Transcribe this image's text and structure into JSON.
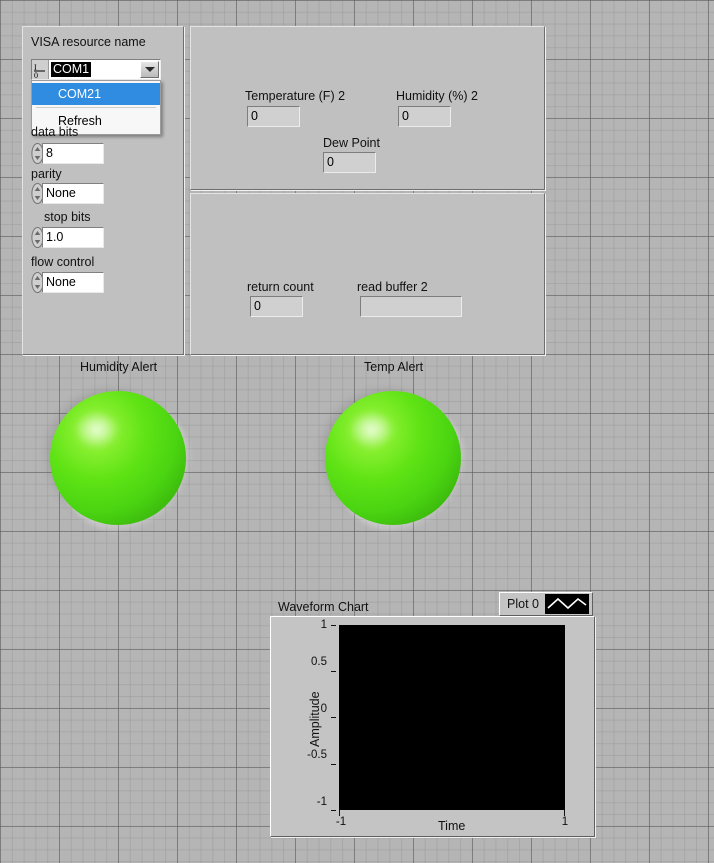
{
  "window": {
    "title": "LabVIEW Front Panel",
    "background_color": "#b5b5b5",
    "panel_color": "#c0c0c0"
  },
  "serial_config_panel": {
    "name": "serial-configuration-panel",
    "visa": {
      "label": "VISA resource name",
      "value": "COM1",
      "io_glyph": "I/O",
      "dropdown_open": true,
      "options": [
        {
          "label": "COM21",
          "selected": true
        },
        {
          "label": "Refresh",
          "selected": false
        }
      ]
    },
    "fields": [
      {
        "label": "data bits",
        "value": "8"
      },
      {
        "label": "parity",
        "value": "None"
      },
      {
        "label": "stop bits",
        "value": "1.0"
      },
      {
        "label": "flow control",
        "value": "None"
      }
    ]
  },
  "readings_panel": {
    "name": "sensor-readings-panel",
    "indicators": [
      {
        "label": "Temperature (F) 2",
        "value": "0"
      },
      {
        "label": "Humidity (%) 2",
        "value": "0"
      },
      {
        "label": "Dew Point",
        "value": "0"
      }
    ]
  },
  "serial_status_panel": {
    "name": "serial-status-panel",
    "indicators": [
      {
        "label": "return count",
        "value": "0"
      },
      {
        "label": "read buffer 2",
        "value": ""
      }
    ]
  },
  "leds": [
    {
      "label": "Humidity Alert",
      "state": "on",
      "color": "#4fd914"
    },
    {
      "label": "Temp Alert",
      "state": "on",
      "color": "#4fd914"
    }
  ],
  "chart_data": {
    "type": "line",
    "title": "Waveform Chart",
    "xlabel": "Time",
    "ylabel": "Amplitude",
    "xlim": [
      -1,
      1
    ],
    "ylim": [
      -1,
      1
    ],
    "x_ticks": [
      "-1",
      "1"
    ],
    "y_ticks": [
      "1",
      "0.5",
      "0",
      "-0.5",
      "-1"
    ],
    "grid": false,
    "plot_background": "#000000",
    "series": [
      {
        "name": "Plot 0",
        "color": "#ffffff",
        "x": [],
        "values": []
      }
    ],
    "legend": {
      "position": "top-right",
      "entries": [
        {
          "label": "Plot 0",
          "line_color": "#ffffff"
        }
      ]
    }
  }
}
